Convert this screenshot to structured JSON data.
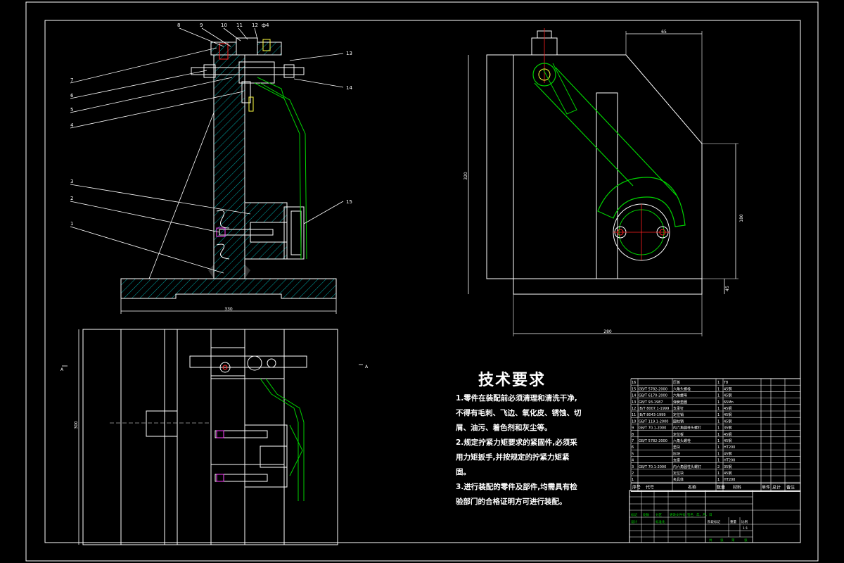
{
  "drawing": {
    "part_labels_left": [
      "7",
      "6",
      "5",
      "4",
      "3",
      "2",
      "1"
    ],
    "part_labels_top": [
      "8",
      "9",
      "10",
      "11",
      "12",
      "ф4"
    ],
    "part_labels_right": [
      "13",
      "14",
      "15"
    ],
    "dim_left_width": "330",
    "dim_top_view": "300",
    "dim_side_height": "320",
    "dim_side_top": "65",
    "dim_side_mid": "180",
    "dim_side_low": "45",
    "dim_side_width": "280",
    "section_mark": "A"
  },
  "technical_requirements": {
    "title": "技术要求",
    "items": [
      "1.零件在装配前必须清理和清洗干净,不得有毛刺、飞边、氧化皮、锈蚀、切屑、油污、着色剂和灰尘等。",
      "2.规定拧紧力矩要求的紧固件,必须采用力矩扳手,并按规定的拧紧力矩紧固。",
      "3.进行装配的零件及部件,均需具有检验部门的合格证明方可进行装配。"
    ]
  },
  "bom": {
    "header": [
      "序号",
      "代号",
      "名称",
      "数量",
      "材料",
      "单件",
      "总计",
      "备注"
    ],
    "rows": [
      [
        "16",
        "",
        "压板",
        "1",
        "T8",
        "",
        ""
      ],
      [
        "15",
        "GB/T 5782-2000",
        "六角头螺栓",
        "1",
        "45钢",
        "",
        ""
      ],
      [
        "14",
        "GB/T 6170-2000",
        "六角螺母",
        "1",
        "45钢",
        "",
        ""
      ],
      [
        "13",
        "GB/T 93-1987",
        "弹簧垫圈",
        "1",
        "65Mn",
        "",
        ""
      ],
      [
        "12",
        "JB/T 8007.1-1999",
        "支承钉",
        "1",
        "45钢",
        "",
        ""
      ],
      [
        "11",
        "JB/T 8043-1999",
        "定位销",
        "1",
        "45钢",
        "",
        ""
      ],
      [
        "10",
        "GB/T 119.1-2000",
        "圆柱销",
        "1",
        "45钢",
        "",
        ""
      ],
      [
        "9",
        "GB/T 70.1-2000",
        "内六角圆柱头螺钉",
        "1",
        "35钢",
        "",
        ""
      ],
      [
        "8",
        "",
        "定位板",
        "1",
        "45钢",
        "",
        ""
      ],
      [
        "7",
        "GB/T 5782-2000",
        "六角头螺栓",
        "1",
        "45钢",
        "",
        ""
      ],
      [
        "6",
        "",
        "垫块",
        "1",
        "HT200",
        "",
        ""
      ],
      [
        "5",
        "",
        "压块",
        "1",
        "45钢",
        "",
        ""
      ],
      [
        "4",
        "",
        "支座",
        "1",
        "HT200",
        "",
        ""
      ],
      [
        "3",
        "GB/T 70.1-2000",
        "内六角圆柱头螺钉",
        "2",
        "35钢",
        "",
        ""
      ],
      [
        "2",
        "",
        "定位块",
        "1",
        "45钢",
        "",
        ""
      ],
      [
        "1",
        "",
        "夹具体",
        "1",
        "HT200",
        "",
        ""
      ]
    ]
  },
  "title_block": {
    "labels": [
      "标记",
      "处数",
      "分区",
      "更改文件号",
      "签名",
      "年、月、日"
    ],
    "row2": [
      "设计",
      "",
      "标准化",
      "阶段标记",
      "重量",
      "比例"
    ],
    "scale": "1:1",
    "footer": [
      "共",
      "张",
      "第",
      "张"
    ]
  },
  "colors": {
    "background": "#000000",
    "lines": "#ffffff",
    "green": "#00d000",
    "hatch": "#00a8a8",
    "red": "#ff2020",
    "magenta": "#ff40ff",
    "yellow": "#ffff40"
  }
}
